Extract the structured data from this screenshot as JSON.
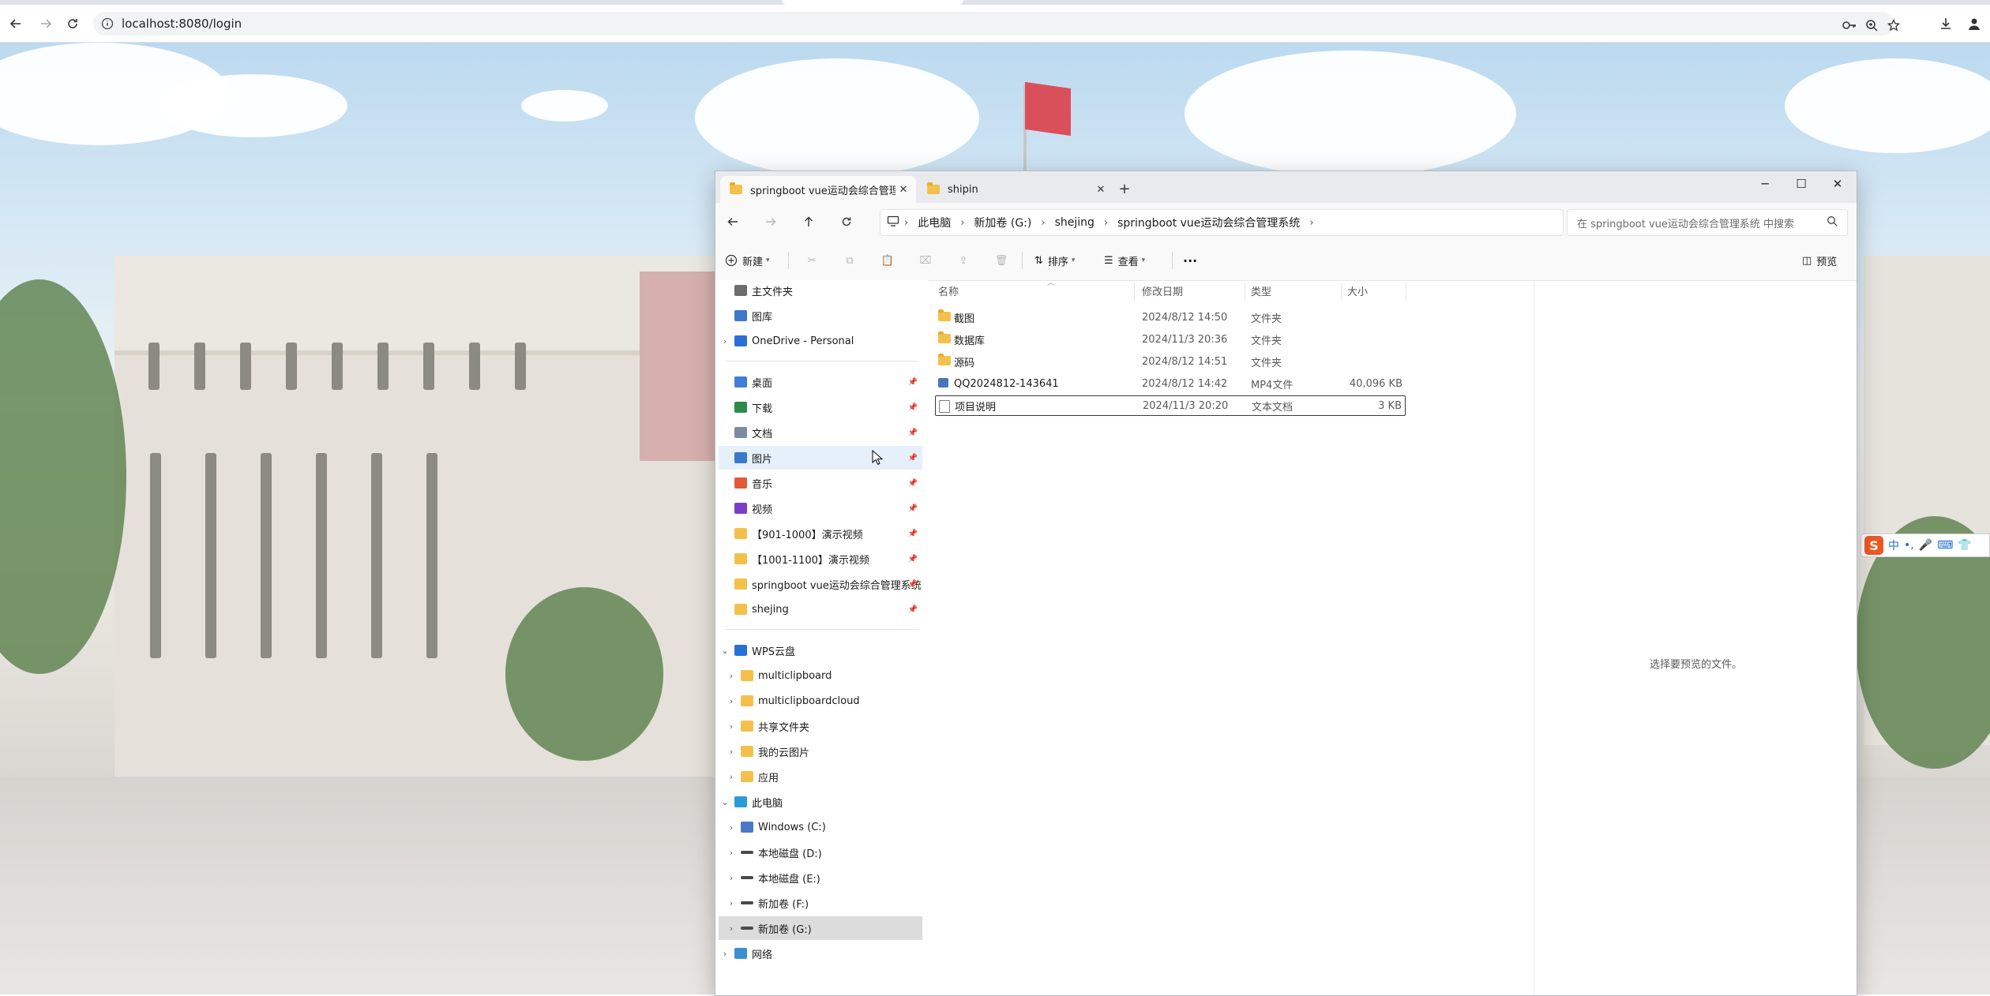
{
  "browser": {
    "url": "localhost:8080/login"
  },
  "ime": {
    "logo": "S",
    "items": [
      "中",
      "•,",
      "🎤",
      "⌨",
      "👕",
      "⋮"
    ]
  },
  "explorer": {
    "tabs": [
      {
        "label": "springboot vue运动会综合管理",
        "active": true
      },
      {
        "label": "shipin",
        "active": false
      }
    ],
    "new_tab": "+",
    "window_controls": {
      "minimize": "─",
      "maximize": "☐",
      "close": "✕"
    },
    "breadcrumb": [
      "此电脑",
      "新加卷 (G:)",
      "shejing",
      "springboot vue运动会综合管理系统"
    ],
    "search_placeholder": "在 springboot vue运动会综合管理系统 中搜索",
    "toolbar": {
      "new": "新建",
      "sort": "排序",
      "view": "查看",
      "more": "···",
      "preview": "预览"
    },
    "sidebar": {
      "quick": [
        {
          "label": "主文件夹",
          "icon": "home-icon"
        },
        {
          "label": "图库",
          "icon": "gallery-icon"
        },
        {
          "label": "OneDrive - Personal",
          "icon": "cloud-icon",
          "expandable": true
        }
      ],
      "pinned": [
        {
          "label": "桌面",
          "icon": "desktop-icon",
          "color": "#3d7fd8"
        },
        {
          "label": "下载",
          "icon": "download-icon",
          "color": "#2f8a4a"
        },
        {
          "label": "文档",
          "icon": "document-icon",
          "color": "#7c8aa3"
        },
        {
          "label": "图片",
          "icon": "pictures-icon",
          "color": "#3b78c9"
        },
        {
          "label": "音乐",
          "icon": "music-icon",
          "color": "#e2593b"
        },
        {
          "label": "视频",
          "icon": "video-icon",
          "color": "#7d3cc7"
        },
        {
          "label": "【901-1000】演示视频",
          "icon": "folder-icon",
          "color": "#f3c14b"
        },
        {
          "label": "【1001-1100】演示视频",
          "icon": "folder-icon",
          "color": "#f3c14b"
        },
        {
          "label": "springboot vue运动会综合管理系统",
          "icon": "folder-icon",
          "color": "#f3c14b"
        },
        {
          "label": "shejing",
          "icon": "folder-icon",
          "color": "#f3c14b"
        }
      ],
      "wps": {
        "label": "WPS云盘",
        "icon": "cloud-icon",
        "children": [
          "multiclipboard",
          "multiclipboardcloud",
          "共享文件夹",
          "我的云图片",
          "应用"
        ]
      },
      "this_pc": {
        "label": "此电脑",
        "icon": "computer-icon",
        "drives": [
          "Windows (C:)",
          "本地磁盘 (D:)",
          "本地磁盘 (E:)",
          "新加卷 (F:)",
          "新加卷 (G:)"
        ]
      },
      "network": {
        "label": "网络",
        "icon": "network-icon"
      }
    },
    "columns": {
      "name": "名称",
      "date": "修改日期",
      "type": "类型",
      "size": "大小"
    },
    "files": [
      {
        "name": "截图",
        "date": "2024/8/12 14:50",
        "type": "文件夹",
        "size": "",
        "kind": "folder"
      },
      {
        "name": "数据库",
        "date": "2024/11/3 20:36",
        "type": "文件夹",
        "size": "",
        "kind": "folder"
      },
      {
        "name": "源码",
        "date": "2024/8/12 14:51",
        "type": "文件夹",
        "size": "",
        "kind": "folder"
      },
      {
        "name": "QQ2024812-143641",
        "date": "2024/8/12 14:42",
        "type": "MP4文件",
        "size": "40,096 KB",
        "kind": "video"
      },
      {
        "name": "项目说明",
        "date": "2024/11/3 20:20",
        "type": "文本文档",
        "size": "3 KB",
        "kind": "text"
      }
    ],
    "preview_message": "选择要预览的文件。"
  }
}
